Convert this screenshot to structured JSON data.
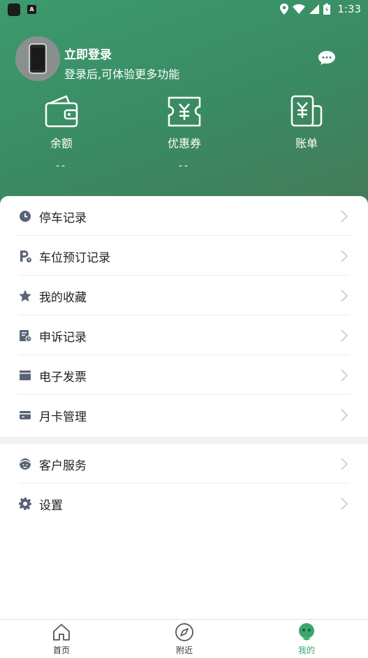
{
  "status_bar": {
    "time": "1:33"
  },
  "profile": {
    "title": "立即登录",
    "subtitle": "登录后,可体验更多功能"
  },
  "stats": [
    {
      "label": "余额",
      "value": "--",
      "icon": "wallet-icon"
    },
    {
      "label": "优惠券",
      "value": "--",
      "icon": "coupon-icon"
    },
    {
      "label": "账单",
      "value": "",
      "icon": "bill-icon"
    }
  ],
  "menu": [
    {
      "label": "停车记录",
      "icon": "clock-icon"
    },
    {
      "label": "车位预订记录",
      "icon": "parking-reserve-icon"
    },
    {
      "label": "我的收藏",
      "icon": "star-icon"
    },
    {
      "label": "申诉记录",
      "icon": "appeal-icon"
    },
    {
      "label": "电子发票",
      "icon": "invoice-icon"
    },
    {
      "label": "月卡管理",
      "icon": "card-icon"
    }
  ],
  "menu2": [
    {
      "label": "客户服务",
      "icon": "customer-service-icon"
    },
    {
      "label": "设置",
      "icon": "settings-icon"
    }
  ],
  "tabs": [
    {
      "label": "首页",
      "icon": "home-icon",
      "active": false
    },
    {
      "label": "附近",
      "icon": "compass-icon",
      "active": false
    },
    {
      "label": "我的",
      "icon": "profile-icon",
      "active": true
    }
  ],
  "colors": {
    "header": "#3d9a6e",
    "accent": "#3aa76d",
    "menu_icon": "#5a6478"
  }
}
